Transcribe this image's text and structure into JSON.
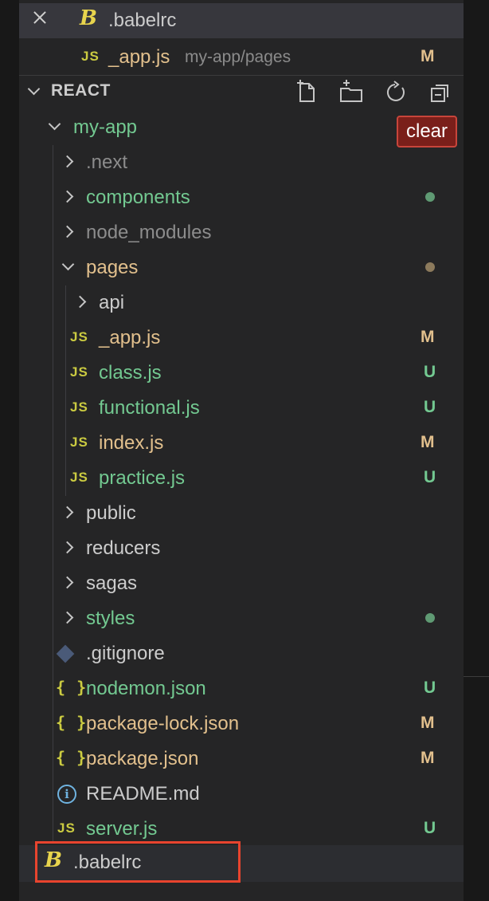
{
  "open_editors": [
    {
      "name": ".babelrc",
      "icon": "babel-icon"
    },
    {
      "name": "_app.js",
      "path": "my-app/pages",
      "status": "M",
      "icon": "js-icon"
    }
  ],
  "explorer": {
    "title": "REACT",
    "actions": [
      "new-file-icon",
      "new-folder-icon",
      "refresh-icon",
      "collapse-all-icon"
    ],
    "clear_label": "clear"
  },
  "tree": {
    "root": "my-app",
    "next": ".next",
    "components": "components",
    "node_modules": "node_modules",
    "pages": "pages",
    "api": "api",
    "app_js": {
      "name": "_app.js",
      "status": "M"
    },
    "class_js": {
      "name": "class.js",
      "status": "U"
    },
    "functional_js": {
      "name": "functional.js",
      "status": "U"
    },
    "index_js": {
      "name": "index.js",
      "status": "M"
    },
    "practice_js": {
      "name": "practice.js",
      "status": "U"
    },
    "public": "public",
    "reducers": "reducers",
    "sagas": "sagas",
    "styles": "styles",
    "gitignore": ".gitignore",
    "nodemon_json": {
      "name": "nodemon.json",
      "status": "U"
    },
    "package_lock_json": {
      "name": "package-lock.json",
      "status": "M"
    },
    "package_json": {
      "name": "package.json",
      "status": "M"
    },
    "readme": "README.md",
    "server_js": {
      "name": "server.js",
      "status": "U"
    },
    "babelrc": ".babelrc"
  },
  "icon_labels": {
    "js": "JS",
    "json": "{ }",
    "babel": "B",
    "info": "i"
  },
  "colors": {
    "untracked": "#73c991",
    "modified": "#e2c08d",
    "ignored": "#8c8c8c",
    "selection_outline": "#e8442e",
    "clear_button": "#7a1f1a"
  }
}
